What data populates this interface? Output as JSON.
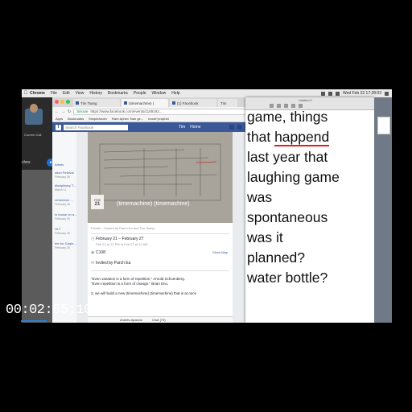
{
  "menubar": {
    "app": "Chrome",
    "items": [
      "File",
      "Edit",
      "View",
      "History",
      "Bookmarks",
      "People",
      "Window",
      "Help"
    ],
    "clock": "Wed Feb 22 17:28:03"
  },
  "call": {
    "label": "Current Call",
    "name_partial": "ches"
  },
  "chrome": {
    "tabs": [
      {
        "label": "Tim Tsang"
      },
      {
        "label": "(timemachine) ("
      },
      {
        "label": "(1) Facebook"
      },
      {
        "label": "Tim"
      }
    ],
    "url_secure": "Secure",
    "url": "https://www.facebook.com/events/1189193...",
    "bookmarks": [
      "Apps",
      "Bookmarks",
      "SimpleAnder",
      "Rare Aphex Twin ge...",
      "monk+prophet"
    ]
  },
  "facebook": {
    "search_placeholder": "Search Facebook",
    "nav_user": "Tim",
    "nav_home": "Home",
    "left_items": [
      {
        "label": "Artists"
      },
      {
        "label": "ution Festival",
        "sub": "February 26"
      },
      {
        "label": "disciplinary T...",
        "sub": "March 11"
      },
      {
        "label": "remember ...",
        "sub": "February 26"
      },
      {
        "label": "in house on a...",
        "sub": "February 26"
      },
      {
        "label": "OLT",
        "sub": "February 26"
      },
      {
        "label": "ber for Guqin...",
        "sub": "February 26"
      }
    ],
    "cal_month": "FEB",
    "cal_day": "21",
    "event_title": "(timemachine) (timemachine)",
    "privacy": "Private · Hosted by Parch Ea and Tim Tsang",
    "date_line": "February 21 – February 27",
    "date_sub": "Feb 21 at 12 PM to Feb 27 at 12 AM",
    "location": "C108",
    "show_map": "Show Map",
    "invited": "Invited by Parch Ea",
    "quote1": "\"Even variation is a form of repetition.\" Arnold Schoenberg.",
    "quote2": "\"Even repetition is a form of change.\" Brian Eno.",
    "quote3": "2, we will build a new (timemachine) (timemachine) that is at once",
    "chat_user": "Andrés Aparicio",
    "chat_label": "Chat (79)"
  },
  "notes": {
    "window_title": "Untitled 2",
    "lines": [
      "game, things",
      "that happend",
      "last year that",
      "laughing game",
      "was",
      "spontaneous",
      "was it",
      "planned?",
      "water bottle?"
    ],
    "underlined_word": "happend"
  },
  "timecode": "00:02:55;10"
}
